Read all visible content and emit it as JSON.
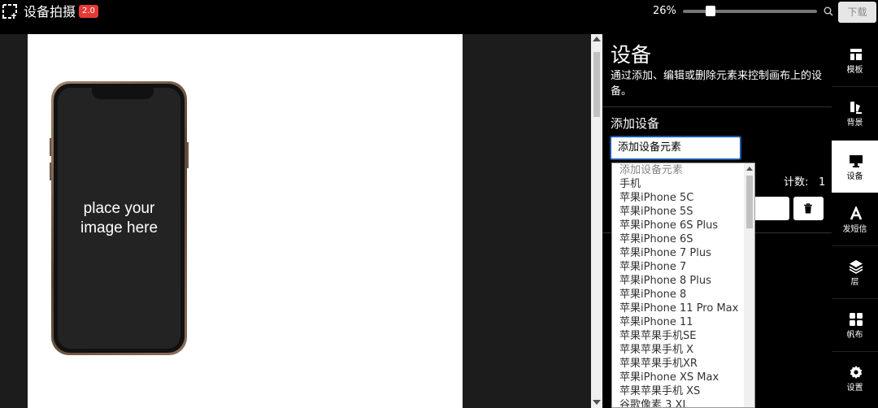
{
  "header": {
    "app_title": "设备拍摄",
    "version": "2.0",
    "zoom_percent": "26%",
    "zoom_level": 0.26,
    "download_label": "下载"
  },
  "canvas": {
    "placeholder_line1": "place your",
    "placeholder_line2": "image here"
  },
  "panel": {
    "heading": "设备",
    "description": "通过添加、编辑或删除元素来控制画布上的设备。",
    "add_device_label": "添加设备",
    "select_value": "添加设备元素",
    "count_label": "计数:",
    "count_value": "1"
  },
  "dropdown": {
    "options": [
      "添加设备元素",
      "手机",
      "苹果iPhone 5C",
      "苹果iPhone 5S",
      "苹果iPhone 6S Plus",
      "苹果iPhone 6S",
      "苹果iPhone 7 Plus",
      "苹果iPhone 7",
      "苹果iPhone 8 Plus",
      "苹果iPhone 8",
      "苹果iPhone 11 Pro Max",
      "苹果iPhone 11",
      "苹果苹果手机SE",
      "苹果苹果手机 X",
      "苹果苹果手机XR",
      "苹果iPhone XS Max",
      "苹果苹果手机 XS",
      "谷歌像素 3 XL"
    ]
  },
  "sidebar": {
    "items": [
      {
        "label": "模板",
        "icon": "template-icon"
      },
      {
        "label": "背景",
        "icon": "background-icon"
      },
      {
        "label": "设备",
        "icon": "monitor-icon"
      },
      {
        "label": "发短信",
        "icon": "text-icon"
      },
      {
        "label": "层",
        "icon": "layers-icon"
      },
      {
        "label": "帆布",
        "icon": "canvas-icon"
      },
      {
        "label": "设置",
        "icon": "gear-icon"
      }
    ],
    "active_index": 2
  },
  "colors": {
    "badge": "#e53935",
    "select_border": "#1a56a8",
    "background": "#000000"
  }
}
